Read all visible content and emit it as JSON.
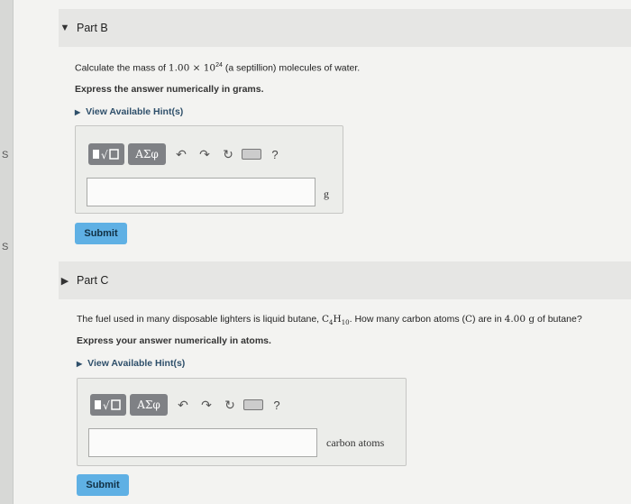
{
  "left_edge": {
    "fragment_1": "S",
    "fragment_2": "S"
  },
  "partB": {
    "title": "Part B",
    "question_pre": "Calculate the mass of ",
    "question_math": "1.00 × 10",
    "question_exp": "24",
    "question_post": " (a septillion) molecules of water.",
    "instruction": "Express the answer numerically in grams.",
    "hint": "View Available Hint(s)",
    "input_value": "",
    "unit": "g",
    "submit": "Submit"
  },
  "partC": {
    "title": "Part C",
    "question_pre": "The fuel used in many disposable lighters is liquid butane, ",
    "formula_c": "C",
    "formula_c_sub": "4",
    "formula_h": "H",
    "formula_h_sub": "10",
    "question_mid": ". How many carbon atoms (",
    "carbon": "C",
    "question_mid2": ") are in ",
    "mass": "4.00 g",
    "question_post": " of butane?",
    "instruction": "Express your answer numerically in atoms.",
    "hint": "View Available Hint(s)",
    "input_value": "",
    "unit": "carbon atoms",
    "submit": "Submit"
  },
  "toolbar": {
    "symbols_label": "ΑΣφ",
    "help_label": "?"
  }
}
